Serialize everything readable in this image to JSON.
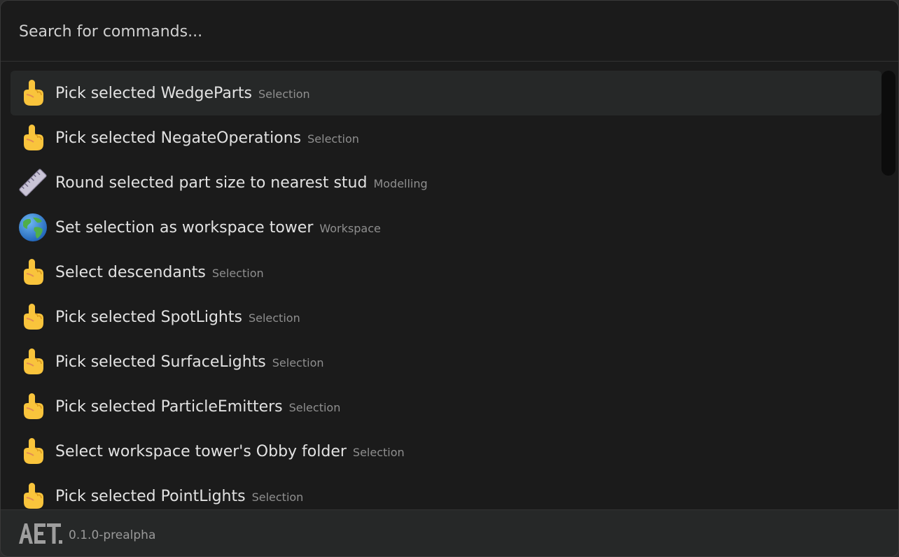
{
  "search": {
    "placeholder": "Search for commands..."
  },
  "commands": [
    {
      "icon": "pointing-hand-icon",
      "label": "Pick selected WedgeParts",
      "category": "Selection",
      "selected": true
    },
    {
      "icon": "pointing-hand-icon",
      "label": "Pick selected NegateOperations",
      "category": "Selection"
    },
    {
      "icon": "ruler-icon",
      "label": "Round selected part size to nearest stud",
      "category": "Modelling"
    },
    {
      "icon": "globe-icon",
      "label": "Set selection as workspace tower",
      "category": "Workspace"
    },
    {
      "icon": "pointing-hand-icon",
      "label": "Select descendants",
      "category": "Selection"
    },
    {
      "icon": "pointing-hand-icon",
      "label": "Pick selected SpotLights",
      "category": "Selection"
    },
    {
      "icon": "pointing-hand-icon",
      "label": "Pick selected SurfaceLights",
      "category": "Selection"
    },
    {
      "icon": "pointing-hand-icon",
      "label": "Pick selected ParticleEmitters",
      "category": "Selection"
    },
    {
      "icon": "pointing-hand-icon",
      "label": "Select workspace tower's Obby folder",
      "category": "Selection"
    },
    {
      "icon": "pointing-hand-icon",
      "label": "Pick selected PointLights",
      "category": "Selection"
    }
  ],
  "footer": {
    "logo": "AET.",
    "version": "0.1.0-prealpha"
  },
  "colors": {
    "background": "#1b1b1b",
    "selected_row": "#262828",
    "footer_bg": "#262828",
    "text": "#e2e2e2",
    "muted_text": "#8f8f8f"
  }
}
